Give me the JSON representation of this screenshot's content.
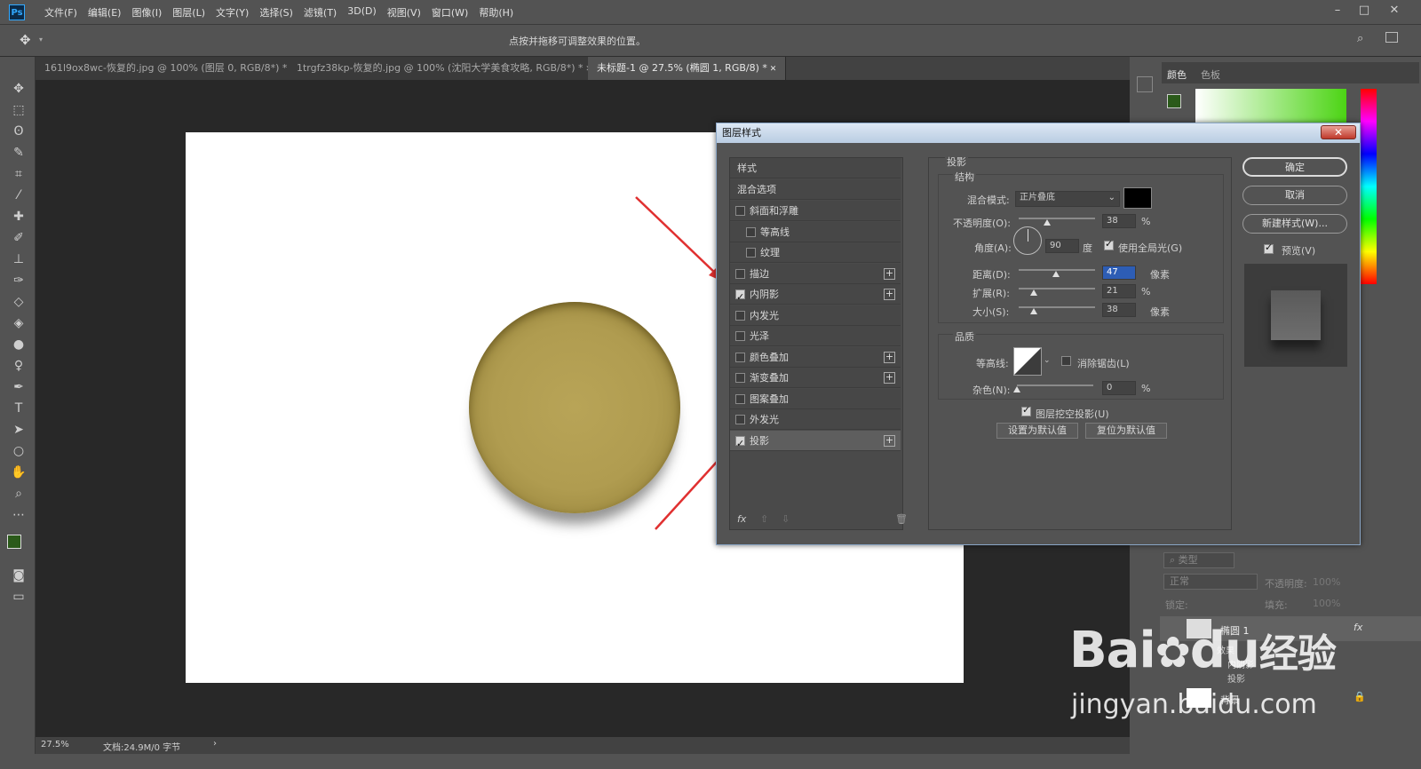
{
  "menubar": {
    "logo": "Ps",
    "items": [
      "文件(F)",
      "编辑(E)",
      "图像(I)",
      "图层(L)",
      "文字(Y)",
      "选择(S)",
      "滤镜(T)",
      "3D(D)",
      "视图(V)",
      "窗口(W)",
      "帮助(H)"
    ]
  },
  "options_bar": {
    "hint": "点按并拖移可调整效果的位置。"
  },
  "tabs": [
    {
      "label": "161l9ox8wc-恢复的.jpg @ 100% (图层 0, RGB/8*) *",
      "active": false
    },
    {
      "label": "1trgfz38kp-恢复的.jpg @ 100% (沈阳大学美食攻略, RGB/8*) *",
      "active": false
    },
    {
      "label": "未标题-1 @ 27.5% (椭圆 1, RGB/8) *",
      "active": true
    }
  ],
  "status": {
    "zoom": "27.5%",
    "doc": "文档:24.9M/0 字节"
  },
  "right_panel": {
    "tab_color": "颜色",
    "tab_swatches": "色板"
  },
  "dialog": {
    "title": "图层样式",
    "close": "✕",
    "styles_header": "样式",
    "blend_options": "混合选项",
    "styles": [
      {
        "label": "斜面和浮雕",
        "checked": false,
        "plus": false,
        "indent": false
      },
      {
        "label": "等高线",
        "checked": false,
        "plus": false,
        "indent": true
      },
      {
        "label": "纹理",
        "checked": false,
        "plus": false,
        "indent": true
      },
      {
        "label": "描边",
        "checked": false,
        "plus": true,
        "indent": false
      },
      {
        "label": "内阴影",
        "checked": true,
        "plus": true,
        "indent": false
      },
      {
        "label": "内发光",
        "checked": false,
        "plus": false,
        "indent": false
      },
      {
        "label": "光泽",
        "checked": false,
        "plus": false,
        "indent": false
      },
      {
        "label": "颜色叠加",
        "checked": false,
        "plus": true,
        "indent": false
      },
      {
        "label": "渐变叠加",
        "checked": false,
        "plus": true,
        "indent": false
      },
      {
        "label": "图案叠加",
        "checked": false,
        "plus": false,
        "indent": false
      },
      {
        "label": "外发光",
        "checked": false,
        "plus": false,
        "indent": false
      },
      {
        "label": "投影",
        "checked": true,
        "plus": true,
        "indent": false,
        "selected": true
      }
    ],
    "fx": "fx",
    "section_title": "投影",
    "structure": {
      "title": "结构",
      "blend_mode_label": "混合模式:",
      "blend_mode_value": "正片叠底",
      "opacity_label": "不透明度(O):",
      "opacity_value": "38",
      "opacity_unit": "%",
      "angle_label": "角度(A):",
      "angle_value": "90",
      "angle_unit": "度",
      "global_light_label": "使用全局光(G)",
      "distance_label": "距离(D):",
      "distance_value": "47",
      "distance_unit": "像素",
      "spread_label": "扩展(R):",
      "spread_value": "21",
      "spread_unit": "%",
      "size_label": "大小(S):",
      "size_value": "38",
      "size_unit": "像素"
    },
    "quality": {
      "title": "品质",
      "contour_label": "等高线:",
      "antialias_label": "消除锯齿(L)",
      "noise_label": "杂色(N):",
      "noise_value": "0",
      "noise_unit": "%",
      "knockout_label": "图层挖空投影(U)",
      "set_default": "设置为默认值",
      "reset_default": "复位为默认值"
    },
    "buttons": {
      "ok": "确定",
      "cancel": "取消",
      "new_style": "新建样式(W)...",
      "preview": "预览(V)"
    }
  },
  "layers": {
    "search": "类型",
    "blend": "正常",
    "opacity_label": "不透明度:",
    "opacity_value": "100%",
    "lock_label": "锁定:",
    "fill_label": "填充:",
    "fill_value": "100%",
    "layer1": "椭圆 1",
    "effects": "效果",
    "effect_inner": "内阴影",
    "effect_shadow": "投影",
    "background": "背景"
  },
  "watermark": {
    "brand": "Bai",
    "brand2": "du",
    "brand_cn": "经验",
    "url": "jingyan.baidu.com"
  },
  "colors": {
    "fg": "#2b5a1a",
    "accent": "#e03030"
  }
}
